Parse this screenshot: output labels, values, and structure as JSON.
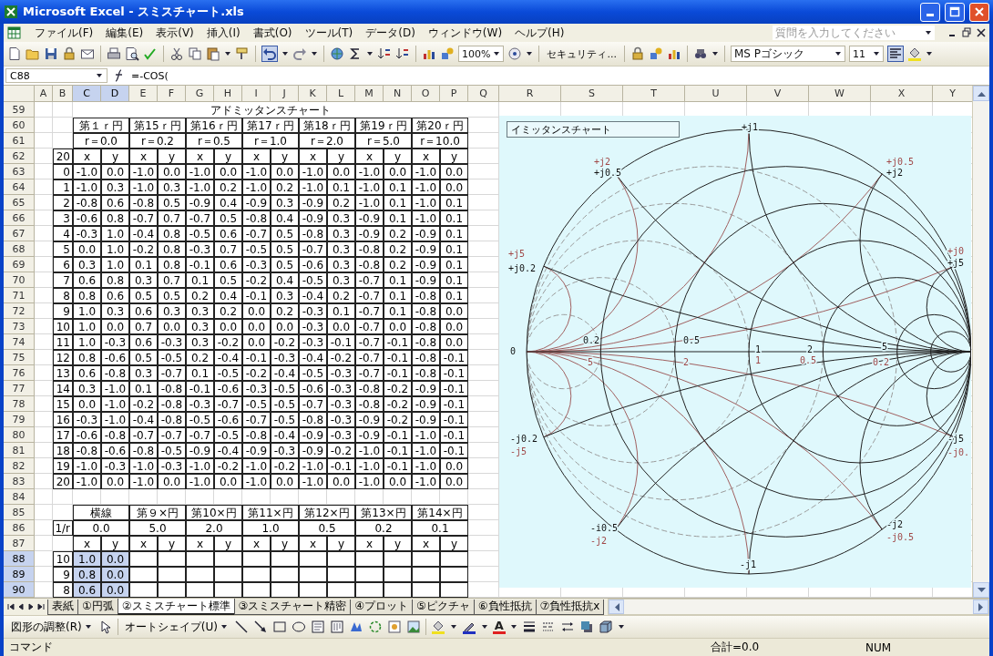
{
  "window": {
    "title": "Microsoft Excel - スミスチャート.xls"
  },
  "menu": [
    "ファイル(F)",
    "編集(E)",
    "表示(V)",
    "挿入(I)",
    "書式(O)",
    "ツール(T)",
    "データ(D)",
    "ウィンドウ(W)",
    "ヘルプ(H)"
  ],
  "help_search": {
    "placeholder": "質問を入力してください"
  },
  "toolbar": {
    "zoom": "100%",
    "security": "セキュリティ...",
    "font": "MS Pゴシック",
    "font_size": "11"
  },
  "formula_bar": {
    "name_box": "C88",
    "formula": "=-COS("
  },
  "columns": [
    {
      "label": "A",
      "selected": false
    },
    {
      "label": "B",
      "selected": false
    },
    {
      "label": "C",
      "selected": true
    },
    {
      "label": "D",
      "selected": true
    },
    {
      "label": "E",
      "selected": false
    },
    {
      "label": "F",
      "selected": false
    },
    {
      "label": "G",
      "selected": false
    },
    {
      "label": "H",
      "selected": false
    },
    {
      "label": "I",
      "selected": false
    },
    {
      "label": "J",
      "selected": false
    },
    {
      "label": "K",
      "selected": false
    },
    {
      "label": "L",
      "selected": false
    },
    {
      "label": "M",
      "selected": false
    },
    {
      "label": "N",
      "selected": false
    },
    {
      "label": "O",
      "selected": false
    },
    {
      "label": "P",
      "selected": false
    },
    {
      "label": "Q",
      "selected": false
    },
    {
      "label": "R",
      "selected": false
    },
    {
      "label": "S",
      "selected": false
    },
    {
      "label": "T",
      "selected": false
    },
    {
      "label": "U",
      "selected": false
    },
    {
      "label": "V",
      "selected": false
    },
    {
      "label": "W",
      "selected": false
    },
    {
      "label": "X",
      "selected": false
    },
    {
      "label": "Y",
      "selected": false
    }
  ],
  "row_numbers": [
    {
      "label": "59",
      "selected": false
    },
    {
      "label": "60",
      "selected": false
    },
    {
      "label": "61",
      "selected": false
    },
    {
      "label": "62",
      "selected": false
    },
    {
      "label": "63",
      "selected": false
    },
    {
      "label": "64",
      "selected": false
    },
    {
      "label": "65",
      "selected": false
    },
    {
      "label": "66",
      "selected": false
    },
    {
      "label": "67",
      "selected": false
    },
    {
      "label": "68",
      "selected": false
    },
    {
      "label": "69",
      "selected": false
    },
    {
      "label": "70",
      "selected": false
    },
    {
      "label": "71",
      "selected": false
    },
    {
      "label": "72",
      "selected": false
    },
    {
      "label": "73",
      "selected": false
    },
    {
      "label": "74",
      "selected": false
    },
    {
      "label": "75",
      "selected": false
    },
    {
      "label": "76",
      "selected": false
    },
    {
      "label": "77",
      "selected": false
    },
    {
      "label": "78",
      "selected": false
    },
    {
      "label": "79",
      "selected": false
    },
    {
      "label": "80",
      "selected": false
    },
    {
      "label": "81",
      "selected": false
    },
    {
      "label": "82",
      "selected": false
    },
    {
      "label": "83",
      "selected": false
    },
    {
      "label": "84",
      "selected": false
    },
    {
      "label": "85",
      "selected": false
    },
    {
      "label": "86",
      "selected": false
    },
    {
      "label": "87",
      "selected": false
    },
    {
      "label": "88",
      "selected": true
    },
    {
      "label": "89",
      "selected": true
    },
    {
      "label": "90",
      "selected": true
    }
  ],
  "sheet": {
    "title": "アドミッタンスチャート",
    "circle_headers": [
      "第１ｒ円",
      "第15ｒ円",
      "第16ｒ円",
      "第17ｒ円",
      "第18ｒ円",
      "第19ｒ円",
      "第20ｒ円"
    ],
    "r_values": [
      "r＝0.0",
      "r＝0.2",
      "r＝0.5",
      "r＝1.0",
      "r＝2.0",
      "r＝5.0",
      "r＝10.0"
    ],
    "step_count": "20",
    "xy_headers": [
      "x",
      "y",
      "x",
      "y",
      "x",
      "y",
      "x",
      "y",
      "x",
      "y",
      "x",
      "y",
      "x",
      "y"
    ],
    "rows": [
      {
        "index": "0",
        "values": [
          "-1.0",
          "0.0",
          "-1.0",
          "0.0",
          "-1.0",
          "0.0",
          "-1.0",
          "0.0",
          "-1.0",
          "0.0",
          "-1.0",
          "0.0",
          "-1.0",
          "0.0"
        ]
      },
      {
        "index": "1",
        "values": [
          "-1.0",
          "0.3",
          "-1.0",
          "0.3",
          "-1.0",
          "0.2",
          "-1.0",
          "0.2",
          "-1.0",
          "0.1",
          "-1.0",
          "0.1",
          "-1.0",
          "0.0"
        ]
      },
      {
        "index": "2",
        "values": [
          "-0.8",
          "0.6",
          "-0.8",
          "0.5",
          "-0.9",
          "0.4",
          "-0.9",
          "0.3",
          "-0.9",
          "0.2",
          "-1.0",
          "0.1",
          "-1.0",
          "0.1"
        ]
      },
      {
        "index": "3",
        "values": [
          "-0.6",
          "0.8",
          "-0.7",
          "0.7",
          "-0.7",
          "0.5",
          "-0.8",
          "0.4",
          "-0.9",
          "0.3",
          "-0.9",
          "0.1",
          "-1.0",
          "0.1"
        ]
      },
      {
        "index": "4",
        "values": [
          "-0.3",
          "1.0",
          "-0.4",
          "0.8",
          "-0.5",
          "0.6",
          "-0.7",
          "0.5",
          "-0.8",
          "0.3",
          "-0.9",
          "0.2",
          "-0.9",
          "0.1"
        ]
      },
      {
        "index": "5",
        "values": [
          "0.0",
          "1.0",
          "-0.2",
          "0.8",
          "-0.3",
          "0.7",
          "-0.5",
          "0.5",
          "-0.7",
          "0.3",
          "-0.8",
          "0.2",
          "-0.9",
          "0.1"
        ]
      },
      {
        "index": "6",
        "values": [
          "0.3",
          "1.0",
          "0.1",
          "0.8",
          "-0.1",
          "0.6",
          "-0.3",
          "0.5",
          "-0.6",
          "0.3",
          "-0.8",
          "0.2",
          "-0.9",
          "0.1"
        ]
      },
      {
        "index": "7",
        "values": [
          "0.6",
          "0.8",
          "0.3",
          "0.7",
          "0.1",
          "0.5",
          "-0.2",
          "0.4",
          "-0.5",
          "0.3",
          "-0.7",
          "0.1",
          "-0.9",
          "0.1"
        ]
      },
      {
        "index": "8",
        "values": [
          "0.8",
          "0.6",
          "0.5",
          "0.5",
          "0.2",
          "0.4",
          "-0.1",
          "0.3",
          "-0.4",
          "0.2",
          "-0.7",
          "0.1",
          "-0.8",
          "0.1"
        ]
      },
      {
        "index": "9",
        "values": [
          "1.0",
          "0.3",
          "0.6",
          "0.3",
          "0.3",
          "0.2",
          "0.0",
          "0.2",
          "-0.3",
          "0.1",
          "-0.7",
          "0.1",
          "-0.8",
          "0.0"
        ]
      },
      {
        "index": "10",
        "values": [
          "1.0",
          "0.0",
          "0.7",
          "0.0",
          "0.3",
          "0.0",
          "0.0",
          "0.0",
          "-0.3",
          "0.0",
          "-0.7",
          "0.0",
          "-0.8",
          "0.0"
        ]
      },
      {
        "index": "11",
        "values": [
          "1.0",
          "-0.3",
          "0.6",
          "-0.3",
          "0.3",
          "-0.2",
          "0.0",
          "-0.2",
          "-0.3",
          "-0.1",
          "-0.7",
          "-0.1",
          "-0.8",
          "0.0"
        ]
      },
      {
        "index": "12",
        "values": [
          "0.8",
          "-0.6",
          "0.5",
          "-0.5",
          "0.2",
          "-0.4",
          "-0.1",
          "-0.3",
          "-0.4",
          "-0.2",
          "-0.7",
          "-0.1",
          "-0.8",
          "-0.1"
        ]
      },
      {
        "index": "13",
        "values": [
          "0.6",
          "-0.8",
          "0.3",
          "-0.7",
          "0.1",
          "-0.5",
          "-0.2",
          "-0.4",
          "-0.5",
          "-0.3",
          "-0.7",
          "-0.1",
          "-0.8",
          "-0.1"
        ]
      },
      {
        "index": "14",
        "values": [
          "0.3",
          "-1.0",
          "0.1",
          "-0.8",
          "-0.1",
          "-0.6",
          "-0.3",
          "-0.5",
          "-0.6",
          "-0.3",
          "-0.8",
          "-0.2",
          "-0.9",
          "-0.1"
        ]
      },
      {
        "index": "15",
        "values": [
          "0.0",
          "-1.0",
          "-0.2",
          "-0.8",
          "-0.3",
          "-0.7",
          "-0.5",
          "-0.5",
          "-0.7",
          "-0.3",
          "-0.8",
          "-0.2",
          "-0.9",
          "-0.1"
        ]
      },
      {
        "index": "16",
        "values": [
          "-0.3",
          "-1.0",
          "-0.4",
          "-0.8",
          "-0.5",
          "-0.6",
          "-0.7",
          "-0.5",
          "-0.8",
          "-0.3",
          "-0.9",
          "-0.2",
          "-0.9",
          "-0.1"
        ]
      },
      {
        "index": "17",
        "values": [
          "-0.6",
          "-0.8",
          "-0.7",
          "-0.7",
          "-0.7",
          "-0.5",
          "-0.8",
          "-0.4",
          "-0.9",
          "-0.3",
          "-0.9",
          "-0.1",
          "-1.0",
          "-0.1"
        ]
      },
      {
        "index": "18",
        "values": [
          "-0.8",
          "-0.6",
          "-0.8",
          "-0.5",
          "-0.9",
          "-0.4",
          "-0.9",
          "-0.3",
          "-0.9",
          "-0.2",
          "-1.0",
          "-0.1",
          "-1.0",
          "-0.1"
        ]
      },
      {
        "index": "19",
        "values": [
          "-1.0",
          "-0.3",
          "-1.0",
          "-0.3",
          "-1.0",
          "-0.2",
          "-1.0",
          "-0.2",
          "-1.0",
          "-0.1",
          "-1.0",
          "-0.1",
          "-1.0",
          "0.0"
        ]
      },
      {
        "index": "20",
        "values": [
          "-1.0",
          "0.0",
          "-1.0",
          "0.0",
          "-1.0",
          "0.0",
          "-1.0",
          "0.0",
          "-1.0",
          "0.0",
          "-1.0",
          "0.0",
          "-1.0",
          "0.0"
        ]
      }
    ],
    "line_headers": [
      "横線",
      "第９×円",
      "第10×円",
      "第11×円",
      "第12×円",
      "第13×円",
      "第14×円"
    ],
    "inv_r_label": "1/r",
    "inv_r_values": [
      "0.0",
      "5.0",
      "2.0",
      "1.0",
      "0.5",
      "0.2",
      "0.1"
    ],
    "xy_headers_2": [
      "x",
      "y",
      "x",
      "y",
      "x",
      "y",
      "x",
      "y",
      "x",
      "y",
      "x",
      "y",
      "x",
      "y"
    ],
    "rows_2": [
      {
        "index": "10",
        "values": [
          "1.0",
          "0.0"
        ],
        "selected": true
      },
      {
        "index": "9",
        "values": [
          "0.8",
          "0.0"
        ],
        "selected": true
      },
      {
        "index": "8",
        "values": [
          "0.6",
          "0.0"
        ],
        "selected": true
      }
    ]
  },
  "chart": {
    "title": "イミッタンスチャート",
    "labels": [
      {
        "text": "+j1",
        "kind": "impedance"
      },
      {
        "text": "+j2",
        "kind": "admittance"
      },
      {
        "text": "+j0.5",
        "kind": "impedance"
      },
      {
        "text": "+j0.5",
        "kind": "admittance"
      },
      {
        "text": "+j2",
        "kind": "impedance"
      },
      {
        "text": "+j5",
        "kind": "admittance"
      },
      {
        "text": "+j0.2",
        "kind": "impedance"
      },
      {
        "text": "+j0",
        "kind": "admittance"
      },
      {
        "text": "+j5",
        "kind": "impedance"
      },
      {
        "text": "0",
        "kind": "impedance"
      },
      {
        "text": "0.2",
        "kind": "impedance"
      },
      {
        "text": "5",
        "kind": "admittance"
      },
      {
        "text": "0.5",
        "kind": "impedance"
      },
      {
        "text": "2",
        "kind": "admittance"
      },
      {
        "text": "1",
        "kind": "impedance"
      },
      {
        "text": "1",
        "kind": "admittance"
      },
      {
        "text": "2",
        "kind": "impedance"
      },
      {
        "text": "0.5",
        "kind": "admittance"
      },
      {
        "text": "5",
        "kind": "impedance"
      },
      {
        "text": "0.2",
        "kind": "admittance"
      },
      {
        "text": "-j0.2",
        "kind": "impedance"
      },
      {
        "text": "-j5",
        "kind": "admittance"
      },
      {
        "text": "-j5",
        "kind": "impedance"
      },
      {
        "text": "-j0.",
        "kind": "admittance"
      },
      {
        "text": "-i0.5",
        "kind": "impedance"
      },
      {
        "text": "-j2",
        "kind": "admittance"
      },
      {
        "text": "-j2",
        "kind": "impedance"
      },
      {
        "text": "-j0.5",
        "kind": "admittance"
      },
      {
        "text": "-j1",
        "kind": "impedance"
      }
    ]
  },
  "sheet_tabs": [
    {
      "label": "表紙",
      "selected": false
    },
    {
      "label": "①円弧",
      "selected": false
    },
    {
      "label": "②スミスチャート標準",
      "selected": true
    },
    {
      "label": "③スミスチャート精密",
      "selected": false
    },
    {
      "label": "④プロット",
      "selected": false
    },
    {
      "label": "⑤ピクチャ",
      "selected": false
    },
    {
      "label": "⑥負性抵抗",
      "selected": false
    },
    {
      "label": "⑦負性抵抗x",
      "selected": false
    }
  ],
  "drawing_toolbar": {
    "adjust": "図形の調整(R)",
    "autoshape": "オートシェイプ(U)",
    "font_color": "A"
  },
  "status_bar": {
    "mode": "コマンド",
    "sum": "合計=0.0",
    "num_lock": "NUM"
  }
}
